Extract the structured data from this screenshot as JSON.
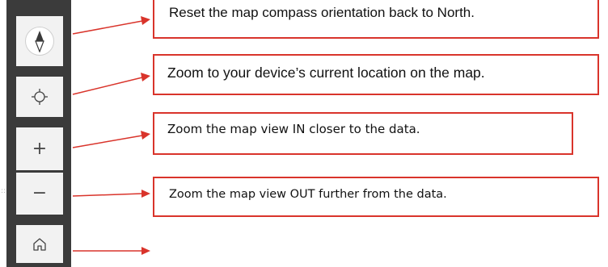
{
  "toolbar": {
    "buttons": [
      {
        "name": "compass",
        "icon": "compass-icon"
      },
      {
        "name": "locate",
        "icon": "crosshair-icon"
      },
      {
        "name": "zoom-in",
        "icon": "plus-icon",
        "glyph": "+"
      },
      {
        "name": "zoom-out",
        "icon": "minus-icon",
        "glyph": "−"
      },
      {
        "name": "home",
        "icon": "home-icon"
      }
    ]
  },
  "callouts": {
    "compass": "Reset the map compass orientation back to North.",
    "locate": "Zoom to your device’s current location on the map.",
    "zoom_in": "Zoom the map view IN closer to the data.",
    "zoom_out": "Zoom the map view OUT further from the data."
  },
  "colors": {
    "toolbar": "#3b3b3b",
    "button": "#f2f2f2",
    "accent": "#d9342b"
  }
}
